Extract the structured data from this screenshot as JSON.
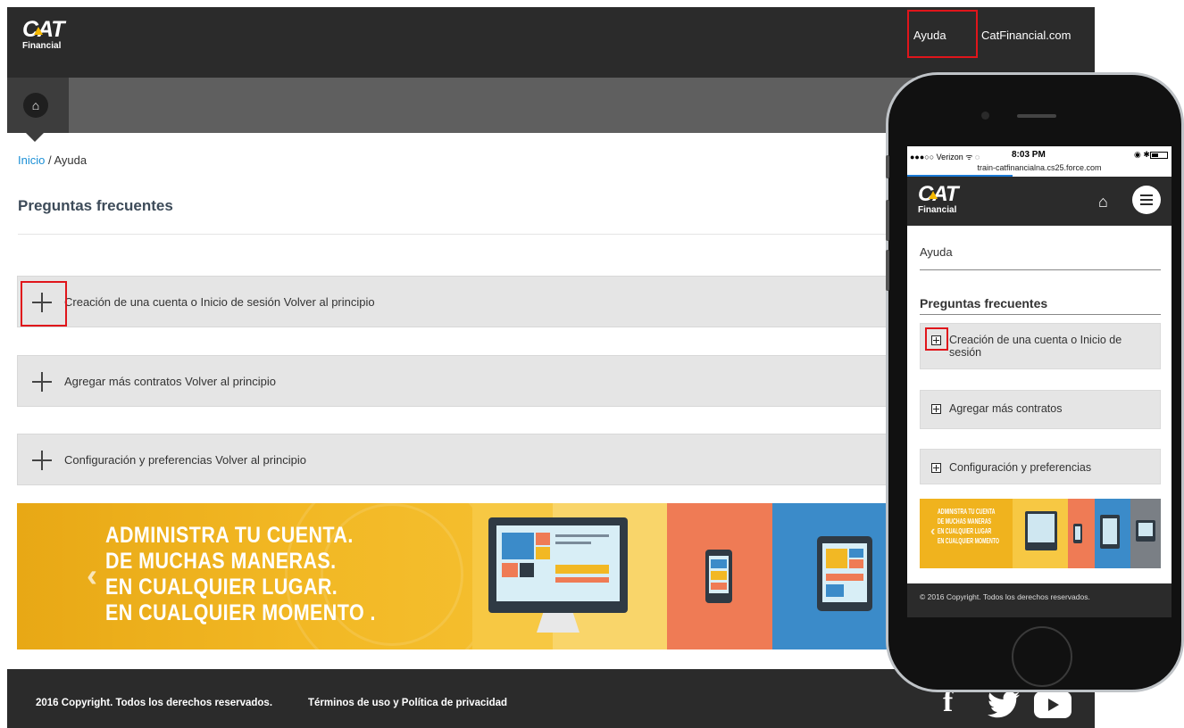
{
  "header": {
    "logo_word": "CAT",
    "logo_sub": "Financial",
    "links": [
      "Ayuda",
      "CatFinancial.com"
    ]
  },
  "nav": {
    "home_icon": "home-icon"
  },
  "breadcrumb": {
    "home": "Inicio",
    "separator": " / ",
    "current": "Ayuda"
  },
  "page_title": "Preguntas frecuentes",
  "accordions": [
    {
      "label": "Creación de una cuenta o Inicio de sesión Volver al principio"
    },
    {
      "label": "Agregar más contratos Volver al principio"
    },
    {
      "label": "Configuración y preferencias Volver al principio"
    }
  ],
  "banner": {
    "lines": [
      "ADMINISTRA TU CUENTA.",
      "DE MUCHAS MANERAS.",
      "EN CUALQUIER LUGAR.",
      "EN CUALQUIER MOMENTO ."
    ],
    "prev_arrow": "‹"
  },
  "footer": {
    "copyright": "2016 Copyright. Todos los derechos reservados.",
    "terms": "Términos de uso y Política de privacidad",
    "social": [
      "facebook-icon",
      "twitter-icon",
      "youtube-icon"
    ]
  },
  "mobile": {
    "status": {
      "carrier": "●●●○○ Verizon ᯤ ◌",
      "time": "8:03 PM",
      "icons": "◉ ✱",
      "url": "train-catfinancialna.cs25.force.com"
    },
    "logo_word": "CAT",
    "logo_sub": "Financial",
    "crumb": "Ayuda",
    "title": "Preguntas frecuentes",
    "accordions": [
      {
        "label": "Creación de una cuenta o Inicio de sesión"
      },
      {
        "label": "Agregar más contratos"
      },
      {
        "label": "Configuración y preferencias"
      }
    ],
    "banner_lines": [
      "ADMINISTRA TU CUENTA",
      "DE MUCHAS MANERAS",
      "EN CUALQUIER LUGAR",
      "EN CUALQUIER MOMENTO"
    ],
    "footer": "© 2016 Copyright. Todos los derechos reservados."
  },
  "colors": {
    "dark": "#2b2b2b",
    "nav": "#5f5f5f",
    "link": "#1a8fd6",
    "highlight": "#e0151b",
    "accordion": "#e5e5e5",
    "banner": "#f1b51f"
  }
}
